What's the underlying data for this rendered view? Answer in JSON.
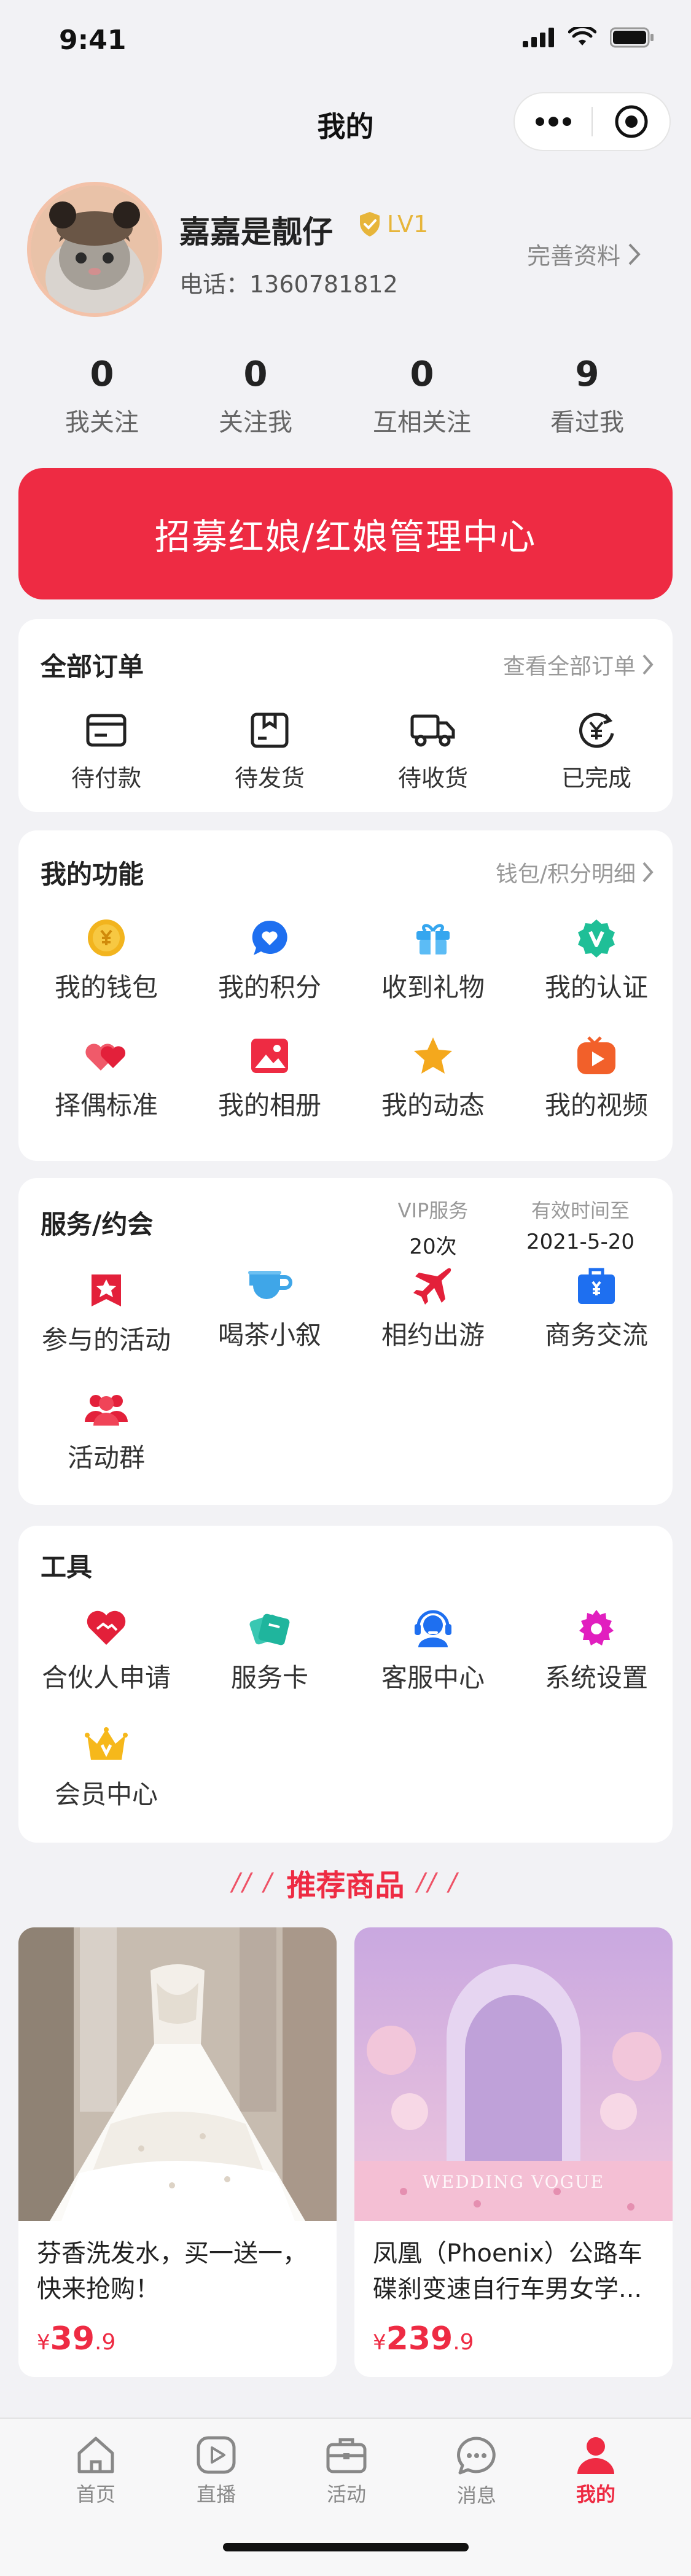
{
  "status_bar": {
    "time": "9:41"
  },
  "nav": {
    "title": "我的"
  },
  "profile": {
    "name": "嘉嘉是靓仔",
    "level": "LV1",
    "phone": "电话：1360781812",
    "complete_link": "完善资料"
  },
  "stats": [
    {
      "num": "0",
      "label": "我关注"
    },
    {
      "num": "0",
      "label": "关注我"
    },
    {
      "num": "0",
      "label": "互相关注"
    },
    {
      "num": "9",
      "label": "看过我"
    }
  ],
  "banner": {
    "text": "招募红娘/红娘管理中心"
  },
  "orders": {
    "title": "全部订单",
    "link": "查看全部订单",
    "items": [
      {
        "label": "待付款",
        "icon": "card-icon"
      },
      {
        "label": "待发货",
        "icon": "package-icon"
      },
      {
        "label": "待收货",
        "icon": "truck-icon"
      },
      {
        "label": "已完成",
        "icon": "yuan-refresh-icon"
      }
    ]
  },
  "functions": {
    "title": "我的功能",
    "link": "钱包/积分明细",
    "items": [
      {
        "label": "我的钱包",
        "icon": "coin-icon"
      },
      {
        "label": "我的积分",
        "icon": "heart-bubble-icon"
      },
      {
        "label": "收到礼物",
        "icon": "gift-icon"
      },
      {
        "label": "我的认证",
        "icon": "verified-icon"
      },
      {
        "label": "择偶标准",
        "icon": "double-heart-icon"
      },
      {
        "label": "我的相册",
        "icon": "photo-icon"
      },
      {
        "label": "我的动态",
        "icon": "star-icon"
      },
      {
        "label": "我的视频",
        "icon": "video-icon"
      }
    ]
  },
  "services": {
    "title": "服务/约会",
    "vip_label": "VIP服务",
    "vip_value": "20次",
    "expire_label": "有效时间至",
    "expire_value": "2021-5-20",
    "items": [
      {
        "label": "参与的活动",
        "icon": "bookmark-star-icon"
      },
      {
        "label": "喝茶小叙",
        "icon": "tea-cup-icon"
      },
      {
        "label": "相约出游",
        "icon": "airplane-icon"
      },
      {
        "label": "商务交流",
        "icon": "briefcase-icon"
      },
      {
        "label": "活动群",
        "icon": "group-icon"
      }
    ]
  },
  "tools": {
    "title": "工具",
    "items": [
      {
        "label": "合伙人申请",
        "icon": "handshake-heart-icon"
      },
      {
        "label": "服务卡",
        "icon": "service-card-icon"
      },
      {
        "label": "客服中心",
        "icon": "headset-icon"
      },
      {
        "label": "系统设置",
        "icon": "gear-icon"
      },
      {
        "label": "会员中心",
        "icon": "crown-icon"
      }
    ]
  },
  "recommend": {
    "title": "推荐商品",
    "products": [
      {
        "name": "芬香洗发水，买一送一，快来抢购！",
        "currency": "¥",
        "price_int": "39",
        "price_dec": ".9"
      },
      {
        "name": "凤凰（Phoenix）公路车碟刹变速自行车男女学...",
        "currency": "¥",
        "price_int": "239",
        "price_dec": ".9",
        "watermark": "WEDDING VOGUE"
      }
    ]
  },
  "tabbar": [
    {
      "label": "首页",
      "icon": "home-icon"
    },
    {
      "label": "直播",
      "icon": "play-icon"
    },
    {
      "label": "活动",
      "icon": "briefcase-outline-icon"
    },
    {
      "label": "消息",
      "icon": "chat-icon"
    },
    {
      "label": "我的",
      "icon": "user-icon",
      "active": true
    }
  ],
  "colors": {
    "accent": "#ee2b43",
    "background": "#f2f2f5",
    "gold": "#e7b53a"
  }
}
